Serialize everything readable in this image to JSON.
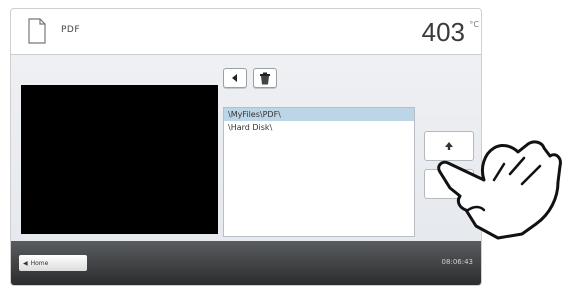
{
  "header": {
    "title": "PDF",
    "temperature": "403",
    "temperature_unit": "°C"
  },
  "toolbar": {
    "back_icon": "back-arrow-icon",
    "delete_icon": "trash-icon"
  },
  "file_list": {
    "items": [
      {
        "label": "\\MyFiles\\PDF\\",
        "selected": true
      },
      {
        "label": "\\Hard Disk\\",
        "selected": false
      }
    ]
  },
  "scroll": {
    "up_icon": "arrow-up-icon",
    "down_icon": "arrow-down-icon"
  },
  "footer": {
    "home_label": "Home",
    "time": "08:06:43"
  },
  "colors": {
    "selection": "#bcd6e8",
    "footer_dark": "#2b2c2e",
    "preview": "#000000"
  }
}
